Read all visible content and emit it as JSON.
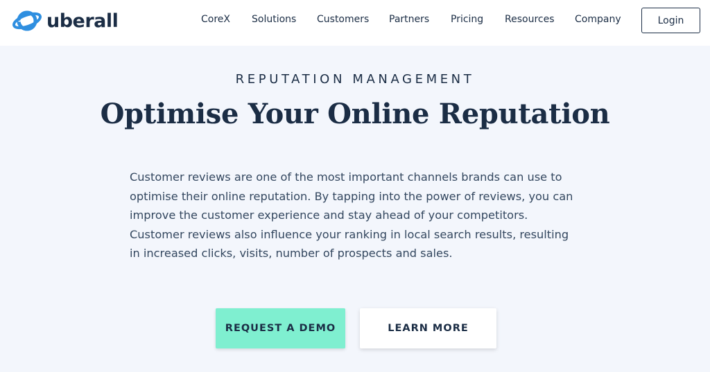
{
  "header": {
    "logo_text": "uberall",
    "nav": [
      "CoreX",
      "Solutions",
      "Customers",
      "Partners",
      "Pricing",
      "Resources",
      "Company"
    ],
    "login_label": "Login"
  },
  "hero": {
    "eyebrow": "REPUTATION MANAGEMENT",
    "title": "Optimise Your Online Reputation",
    "body": "Customer reviews are one of the most important channels brands can use to optimise their online reputation. By tapping into the power of reviews, you can improve the customer experience and stay ahead of your competitors. Customer reviews also influence your ranking in local search results, resulting in increased clicks, visits, number of prospects and sales.",
    "primary_cta": "REQUEST A DEMO",
    "secondary_cta": "LEARN MORE"
  },
  "colors": {
    "brand_blue": "#2f8fe0",
    "navy": "#1b2d45",
    "mint": "#7fefd0",
    "background": "#f3f6fc"
  },
  "icons": {
    "logo": "planet-ring-icon"
  }
}
